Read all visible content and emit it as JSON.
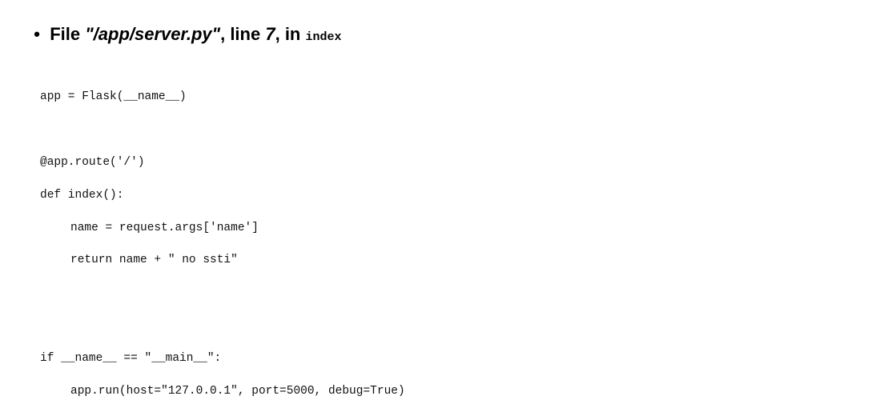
{
  "frame": {
    "bullet": "•",
    "prefix": "File ",
    "filename": "\"/app/server.py\"",
    "line_text": ", line ",
    "line_number": "7",
    "in_text": ", in ",
    "function": "index"
  },
  "code_lines": [
    {
      "text": "app = Flask(__name__)",
      "indent": false
    },
    {
      "text": "",
      "indent": false
    },
    {
      "text": "@app.route('/')",
      "indent": false
    },
    {
      "text": "def index():",
      "indent": false
    },
    {
      "text": "name = request.args['name']",
      "indent": true
    },
    {
      "text": "return name + \" no ssti\"",
      "indent": true
    },
    {
      "text": "",
      "indent": false
    },
    {
      "text": "",
      "indent": false
    },
    {
      "text": "if __name__ == \"__main__\":",
      "indent": false
    },
    {
      "text": "app.run(host=\"127.0.0.1\", port=5000, debug=True)",
      "indent": true
    }
  ]
}
